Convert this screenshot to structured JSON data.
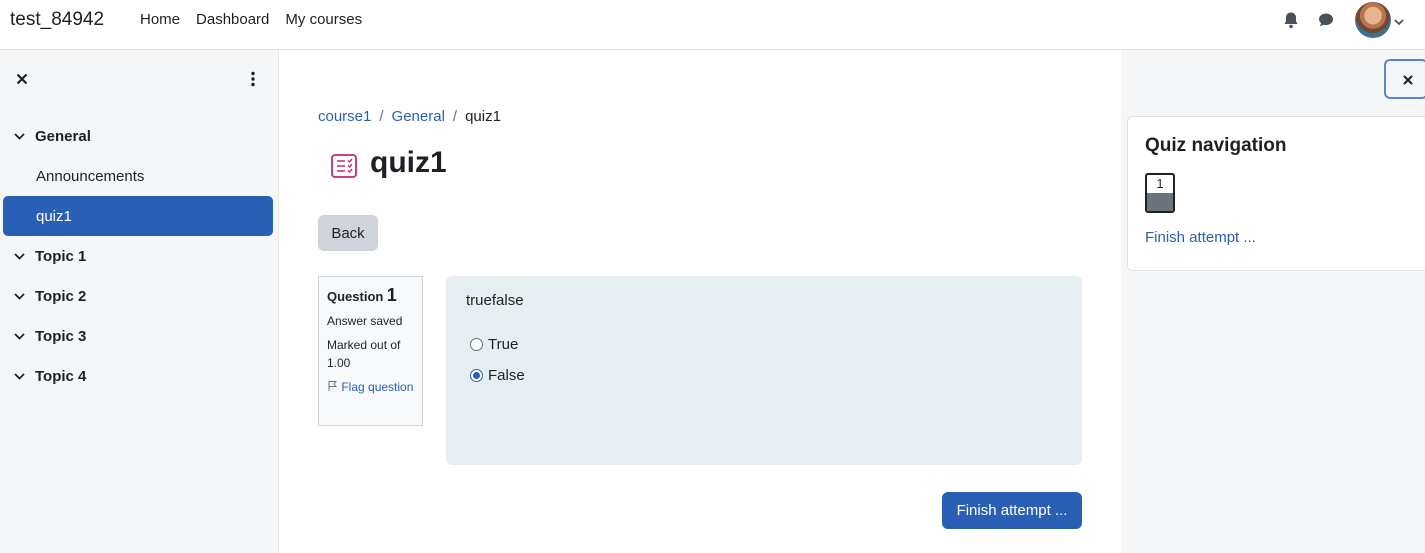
{
  "header": {
    "site_name": "test_84942",
    "nav": [
      "Home",
      "Dashboard",
      "My courses"
    ]
  },
  "course_index": {
    "sections": [
      {
        "title": "General",
        "items": [
          "Announcements",
          "quiz1"
        ]
      },
      {
        "title": "Topic 1"
      },
      {
        "title": "Topic 2"
      },
      {
        "title": "Topic 3"
      },
      {
        "title": "Topic 4"
      }
    ],
    "active_item": "quiz1"
  },
  "breadcrumb": [
    "course1",
    "General",
    "quiz1"
  ],
  "page_title": "quiz1",
  "back_label": "Back",
  "question_info": {
    "label": "Question",
    "number": "1",
    "state": "Answer saved",
    "marks": "Marked out of 1.00",
    "flag": "Flag question"
  },
  "question": {
    "text": "truefalse",
    "options": [
      {
        "label": "True",
        "selected": false
      },
      {
        "label": "False",
        "selected": true
      }
    ]
  },
  "finish_label": "Finish attempt ...",
  "quiz_nav": {
    "title": "Quiz navigation",
    "button_number": "1",
    "finish_link": "Finish attempt ..."
  },
  "colors": {
    "primary": "#2a5fb6",
    "drawer_bg": "#f5f6f8",
    "question_bg": "#e6eef2",
    "quiz_icon": "#c1287a"
  }
}
